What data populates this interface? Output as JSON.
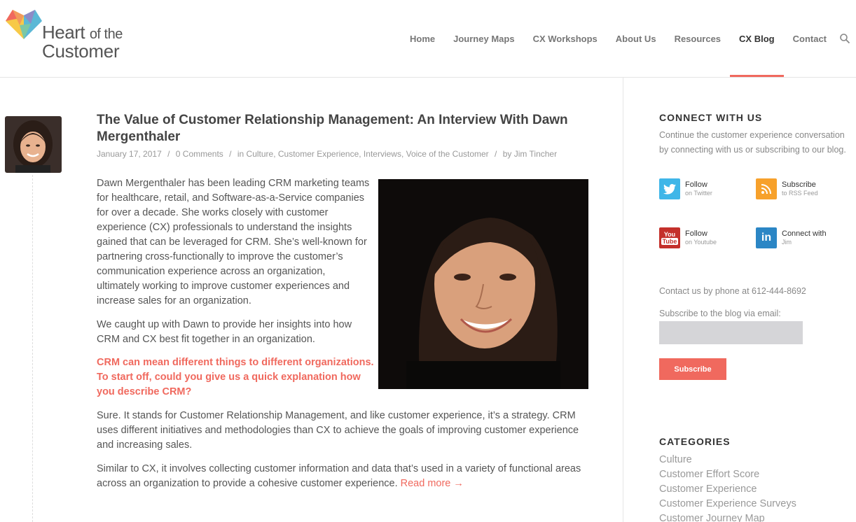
{
  "logo": {
    "line1": "Heart",
    "line1b": "of the",
    "line2": "Customer"
  },
  "nav": {
    "items": [
      {
        "label": "Home"
      },
      {
        "label": "Journey Maps"
      },
      {
        "label": "CX Workshops"
      },
      {
        "label": "About Us"
      },
      {
        "label": "Resources"
      },
      {
        "label": "CX Blog"
      },
      {
        "label": "Contact"
      }
    ],
    "active": "CX Blog",
    "accent": "#f0695e"
  },
  "post": {
    "title": "The Value of Customer Relationship Management: An Interview With Dawn Mergenthaler",
    "date": "January 17, 2017",
    "comments": "0 Comments",
    "in": "in",
    "categories": "Culture, Customer Experience, Interviews, Voice of the Customer",
    "by": "by",
    "author": "Jim Tincher",
    "p1": "Dawn Mergenthaler has been leading CRM marketing teams for healthcare, retail, and Software-as-a-Service companies for over a decade. She works closely with customer experience (CX) professionals to understand the insights gained that can be leveraged for CRM. She’s well-known for partnering cross-functionally to improve the customer’s communication experience across an organization, ultimately working to improve customer experiences and increase sales for an organization.",
    "p2": "We caught up with Dawn to provide her insights into how CRM and CX best fit together in an organization.",
    "question": "CRM can mean different things to different organizations. To start off, could you give us a quick explanation how you describe CRM?",
    "p3": "Sure. It stands for Customer Relationship Management, and like customer experience, it’s a strategy. CRM uses different initiatives and methodologies than CX to achieve the goals of improving customer experience and increasing sales.",
    "p4": "Similar to CX, it involves collecting customer information and data that’s used in a variety of functional areas across an organization to provide a cohesive customer experience.",
    "read_more": "Read more →"
  },
  "sidebar": {
    "connect_heading": "CONNECT WITH US",
    "connect_text": "Continue the customer experience conversation by connecting with us or subscribing to our blog.",
    "social": [
      {
        "icon": "twitter-icon",
        "color": "#3fb6e8",
        "line1": "Follow",
        "line2": "on Twitter"
      },
      {
        "icon": "rss-icon",
        "color": "#f7a12b",
        "line1": "Subscribe",
        "line2": "to RSS Feed"
      },
      {
        "icon": "youtube-icon",
        "color": "#c4302b",
        "line1": "Follow",
        "line2": "on Youtube"
      },
      {
        "icon": "linkedin-icon",
        "color": "#2b86c5",
        "line1": "Connect with",
        "line2": "Jim"
      }
    ],
    "phone_text": "Contact us by phone at 612-444-8692",
    "email_label": "Subscribe to the blog via email:",
    "subscribe_label": "Subscribe",
    "categories_heading": "CATEGORIES",
    "categories": [
      "Culture",
      "Customer Effort Score",
      "Customer Experience",
      "Customer Experience Surveys",
      "Customer Journey Map"
    ]
  }
}
